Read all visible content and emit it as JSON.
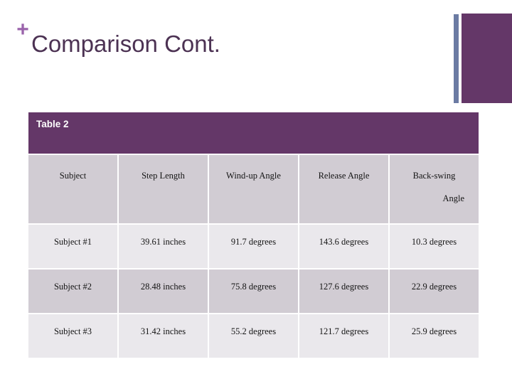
{
  "slide": {
    "title": "Comparison Cont.",
    "bullet_icon": "plus-icon",
    "bullet_glyph": "+",
    "accent_purple": "#643768",
    "accent_light_purple": "#9a63ab",
    "accent_blue_gray": "#6b7ba3",
    "title_color": "#4c3253"
  },
  "table": {
    "caption": "Table 2",
    "columns": [
      "Subject",
      "Step Length",
      "Wind-up Angle",
      "Release Angle",
      "Back-swing"
    ],
    "column_wrap_line2": {
      "back_swing": "Angle"
    },
    "rows": [
      {
        "subject": "Subject #1",
        "step_length": "39.61 inches",
        "wind_up_angle": "91.7 degrees",
        "release_angle": "143.6 degrees",
        "back_swing_angle": "10.3 degrees"
      },
      {
        "subject": "Subject #2",
        "step_length": "28.48 inches",
        "wind_up_angle": "75.8 degrees",
        "release_angle": "127.6 degrees",
        "back_swing_angle": "22.9 degrees"
      },
      {
        "subject": "Subject #3",
        "step_length": "31.42 inches",
        "wind_up_angle": "55.2 degrees",
        "release_angle": "121.7 degrees",
        "back_swing_angle": "25.9 degrees"
      }
    ]
  }
}
